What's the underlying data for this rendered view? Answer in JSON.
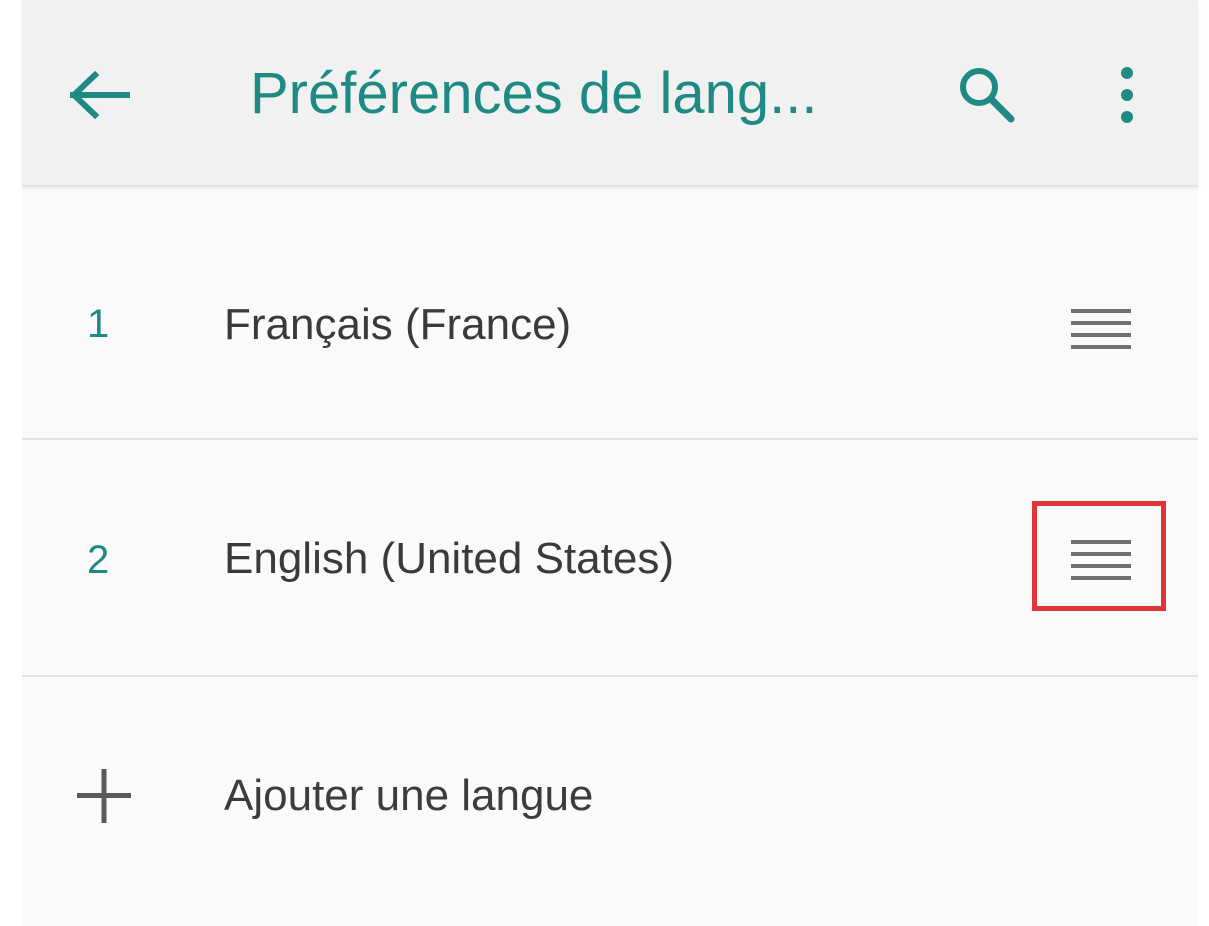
{
  "appbar": {
    "title": "Préférences de lang...",
    "back_icon": "arrow-left-icon",
    "search_icon": "search-icon",
    "more_icon": "more-vert-icon"
  },
  "languages": [
    {
      "index": "1",
      "label": "Français (France)",
      "handle_icon": "drag-handle-icon"
    },
    {
      "index": "2",
      "label": "English (United States)",
      "handle_icon": "drag-handle-icon"
    }
  ],
  "add_language": {
    "label": "Ajouter une langue",
    "icon": "plus-icon"
  },
  "colors": {
    "accent": "#1f8a83",
    "highlight": "#e0343b",
    "text": "#3a3a3a"
  }
}
